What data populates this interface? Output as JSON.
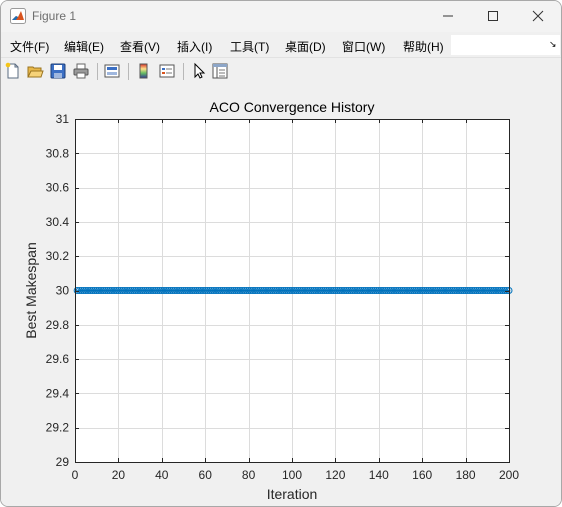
{
  "window": {
    "title": "Figure 1"
  },
  "menu": {
    "items": [
      {
        "key": "file",
        "label": "文件(F)"
      },
      {
        "key": "edit",
        "label": "编辑(E)"
      },
      {
        "key": "view",
        "label": "查看(V)"
      },
      {
        "key": "insert",
        "label": "插入(I)"
      },
      {
        "key": "tools",
        "label": "工具(T)"
      },
      {
        "key": "desktop",
        "label": "桌面(D)"
      },
      {
        "key": "window",
        "label": "窗口(W)"
      },
      {
        "key": "help",
        "label": "帮助(H)"
      }
    ]
  },
  "toolbar": {
    "buttons": [
      "new-figure-icon",
      "open-file-icon",
      "save-icon",
      "print-icon",
      "link-plot-icon",
      "colorbar-icon",
      "legend-icon",
      "pointer-icon",
      "property-inspector-icon"
    ]
  },
  "colors": {
    "series": "#0072bd",
    "grid": "#dcdcdc",
    "axis_text": "#262626",
    "figure_bg": "#f0f0f0"
  },
  "chart_data": {
    "type": "line",
    "title": "ACO Convergence History",
    "xlabel": "Iteration",
    "ylabel": "Best Makespan",
    "xlim": [
      0,
      200
    ],
    "ylim": [
      29,
      31
    ],
    "xticks": [
      0,
      20,
      40,
      60,
      80,
      100,
      120,
      140,
      160,
      180,
      200
    ],
    "xtick_labels": [
      "0",
      "20",
      "40",
      "60",
      "80",
      "100",
      "120",
      "140",
      "160",
      "180",
      "200"
    ],
    "yticks": [
      29,
      29.2,
      29.4,
      29.6,
      29.8,
      30,
      30.2,
      30.4,
      30.6,
      30.8,
      31
    ],
    "ytick_labels": [
      "29",
      "29.2",
      "29.4",
      "29.6",
      "29.8",
      "30",
      "30.2",
      "30.4",
      "30.6",
      "30.8",
      "31"
    ],
    "grid": true,
    "marker": "o",
    "series": [
      {
        "x_start": 1,
        "x_end": 200,
        "value": 30
      }
    ]
  }
}
